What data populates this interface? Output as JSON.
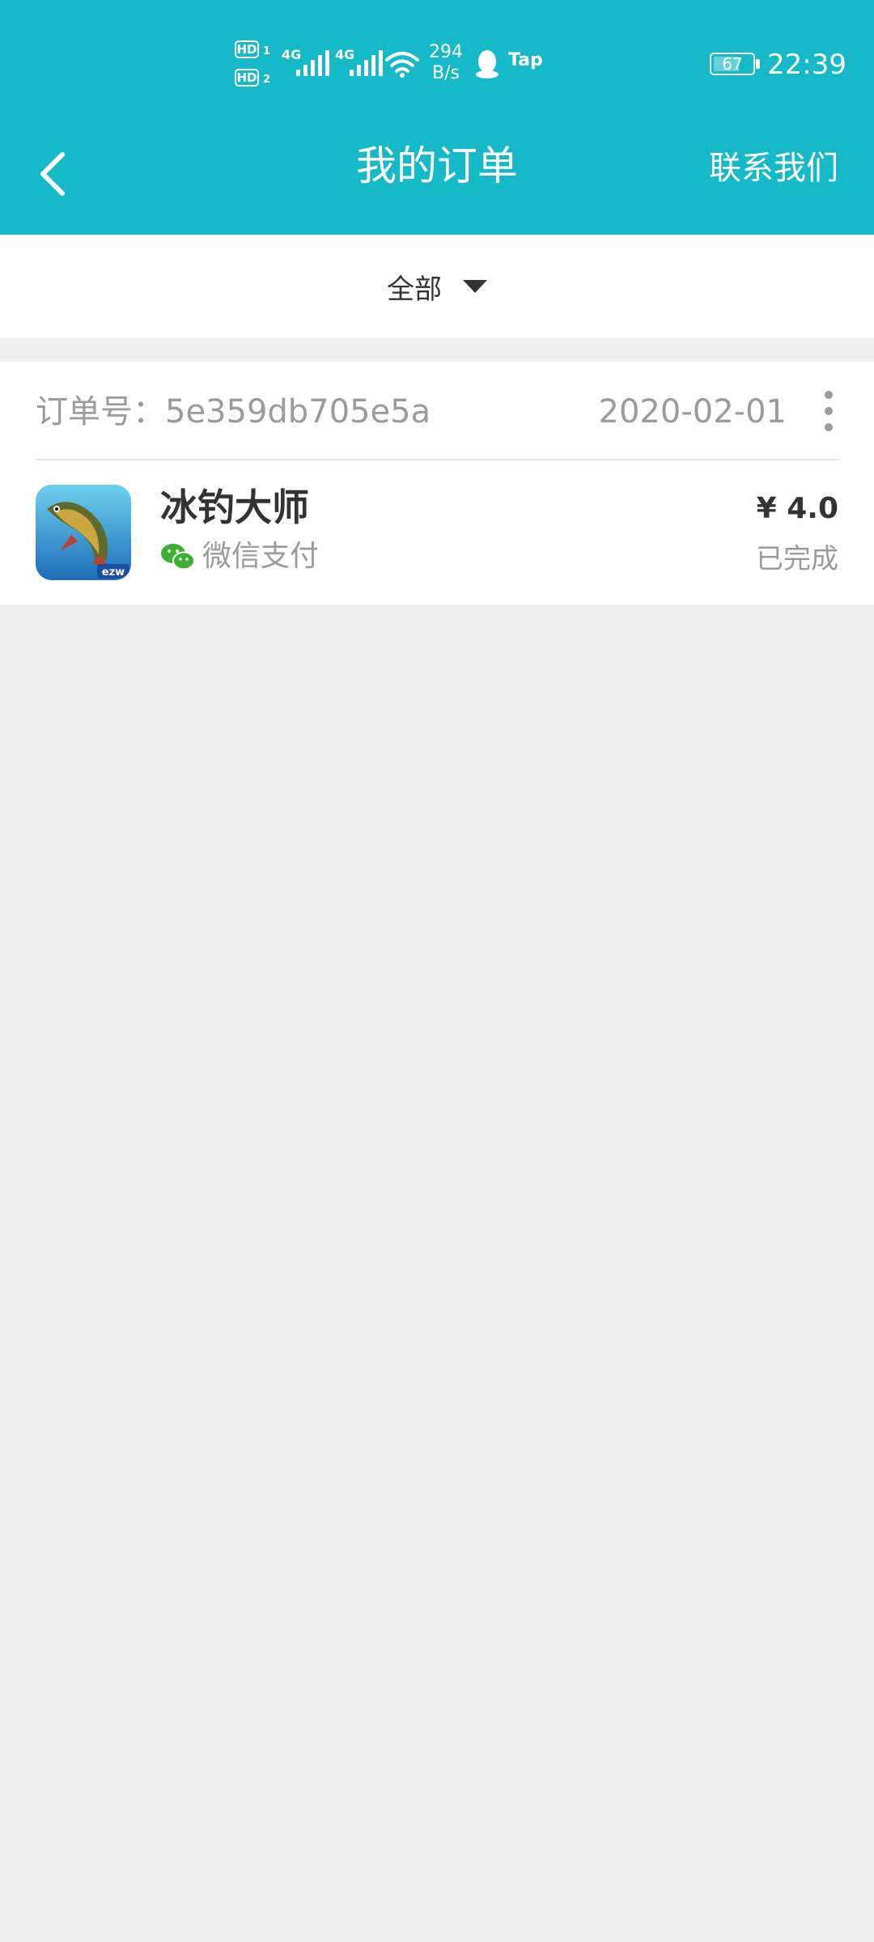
{
  "status_bar": {
    "sim1_label": "HD",
    "sim1_num": "1",
    "sim2_label": "HD",
    "sim2_num": "2",
    "net1_label": "4G",
    "net2_label": "4G",
    "speed_value": "294",
    "speed_unit": "B/s",
    "tap_label": "Tap",
    "battery_level": "67",
    "battery_fraction": 0.67,
    "time": "22:39",
    "icons": [
      "hd-icon",
      "signal-icon",
      "wifi-icon",
      "qq-icon",
      "tap-icon",
      "battery-icon"
    ]
  },
  "title_bar": {
    "back_icon": "chevron-left-icon",
    "title": "我的订单",
    "contact_label": "联系我们"
  },
  "filter": {
    "label": "全部",
    "icon": "triangle-down-icon"
  },
  "orders": [
    {
      "order_no_label": "订单号：5e359db705e5a",
      "date": "2020-02-01",
      "more_icon": "more-vertical-icon",
      "app_name": "冰钓大师",
      "app_icon": "fish-app-icon",
      "app_icon_badge": "ezw",
      "payment_method": "微信支付",
      "payment_icon": "wechat-icon",
      "price": "¥ 4.0",
      "status": "已完成"
    }
  ],
  "colors": {
    "header_bg": "#15b9c8",
    "page_bg": "#eeeeee",
    "card_bg": "#ffffff",
    "primary_text": "#333333",
    "secondary_text": "#9b9b9b",
    "wechat_green": "#3cb034"
  }
}
